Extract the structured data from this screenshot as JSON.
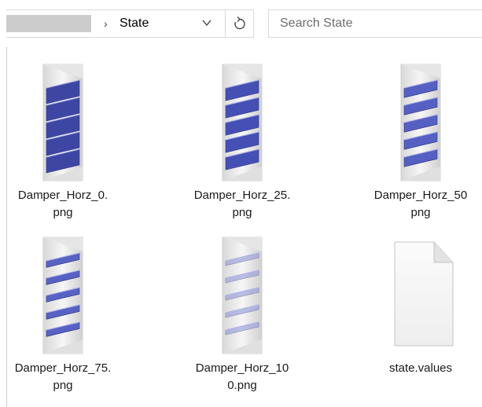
{
  "window": {
    "path_current": "State",
    "search_placeholder": "Search State",
    "accent": "#3a4ba8"
  },
  "files": [
    {
      "name_line1": "Damper_Horz_0.",
      "name_line2": "png",
      "blade_angle": 0,
      "blade_color": "#3d47a3",
      "icon": "damper-image"
    },
    {
      "name_line1": "Damper_Horz_25.",
      "name_line2": "png",
      "blade_angle": 25,
      "blade_color": "#4550b5",
      "icon": "damper-image"
    },
    {
      "name_line1": "Damper_Horz_50",
      "name_line2": "png",
      "blade_angle": 50,
      "blade_color": "#5560c2",
      "icon": "damper-image"
    },
    {
      "name_line1": "Damper_Horz_75.",
      "name_line2": "png",
      "blade_angle": 75,
      "blade_color": "#5862c4",
      "icon": "damper-image"
    },
    {
      "name_line1": "Damper_Horz_10",
      "name_line2": "0.png",
      "blade_angle": 100,
      "blade_color": "#8a92d6",
      "icon": "damper-image"
    },
    {
      "name_line1": "state.values",
      "name_line2": "",
      "icon": "blank-document"
    }
  ]
}
